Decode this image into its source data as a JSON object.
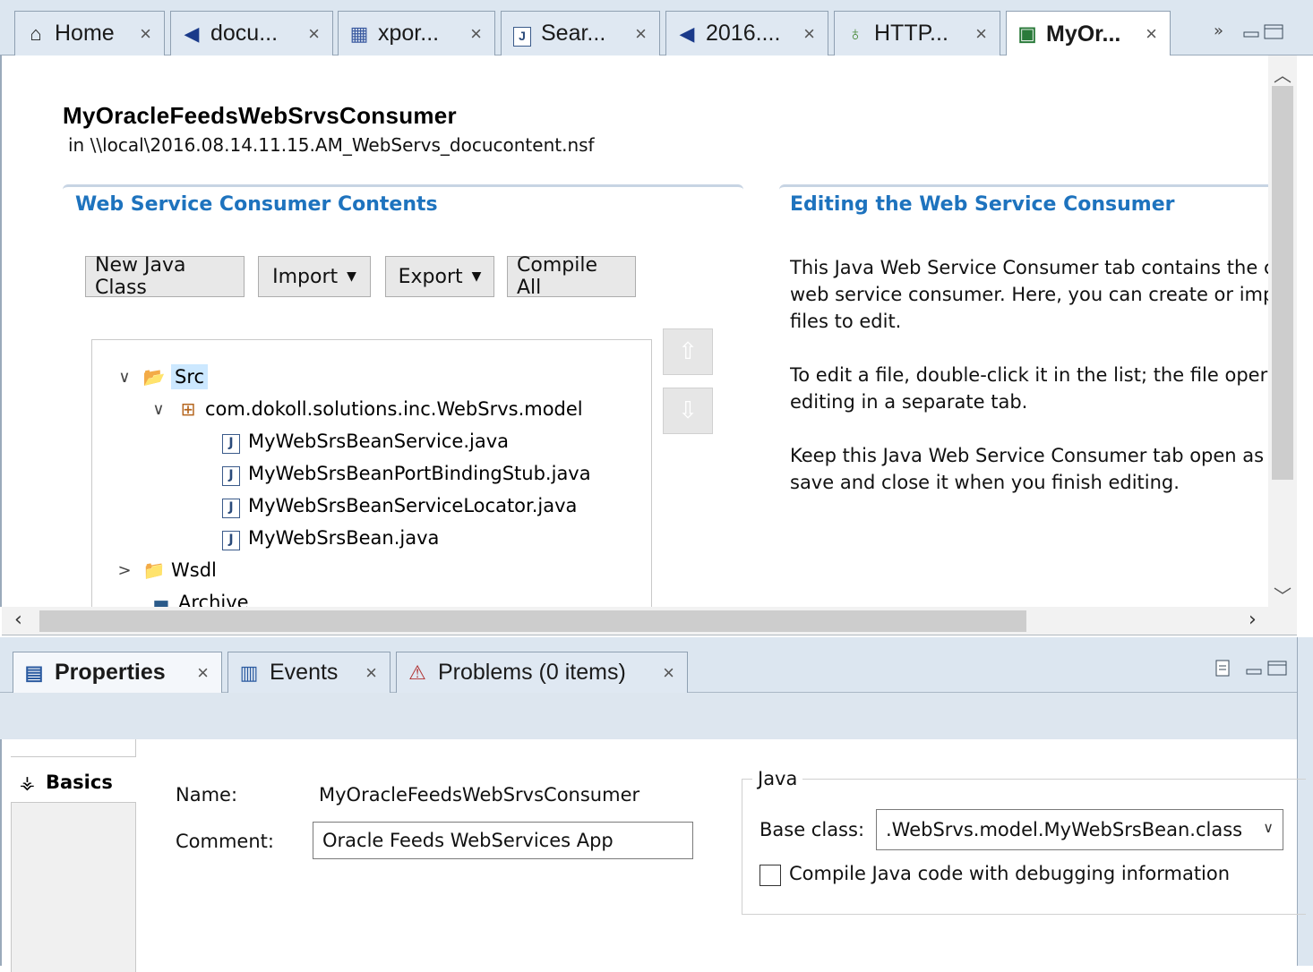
{
  "editor_tabs": [
    {
      "label": "Home",
      "icon": "home-icon",
      "glyph": "⌂"
    },
    {
      "label": "docu...",
      "icon": "flag-icon",
      "glyph": "◀"
    },
    {
      "label": "xpor...",
      "icon": "xpage-icon",
      "glyph": "▦"
    },
    {
      "label": "Sear...",
      "icon": "java-file-icon",
      "glyph": "J"
    },
    {
      "label": "2016....",
      "icon": "flag-icon",
      "glyph": "◀"
    },
    {
      "label": "HTTP...",
      "icon": "lightbulb-icon",
      "glyph": "♁"
    },
    {
      "label": "MyOr...",
      "icon": "web-service-consumer-icon",
      "glyph": "▣"
    }
  ],
  "tab_close_glyph": "×",
  "overflow_glyph": "»",
  "editor": {
    "title": "MyOracleFeedsWebSrvsConsumer",
    "path": "in \\\\local\\2016.08.14.11.15.AM_WebServs_docucontent.nsf",
    "contents_heading": "Web Service Consumer Contents",
    "editing_heading": "Editing the Web Service Consumer",
    "buttons": {
      "new_java_class": "New Java Class",
      "import": "Import",
      "export": "Export",
      "compile_all": "Compile All"
    },
    "tree": [
      {
        "label": "Src",
        "icon": "source-folder-icon",
        "glyph": "📂",
        "twisty": "∨",
        "selected": true
      },
      {
        "label": "com.dokoll.solutions.inc.WebSrvs.model",
        "icon": "package-icon",
        "glyph": "⊞",
        "twisty": "∨"
      },
      {
        "label": "MyWebSrsBeanService.java",
        "icon": "java-file-icon",
        "glyph": "J"
      },
      {
        "label": "MyWebSrsBeanPortBindingStub.java",
        "icon": "java-file-icon",
        "glyph": "J"
      },
      {
        "label": "MyWebSrsBeanServiceLocator.java",
        "icon": "java-file-icon",
        "glyph": "J"
      },
      {
        "label": "MyWebSrsBean.java",
        "icon": "java-file-icon",
        "glyph": "J"
      },
      {
        "label": "Wsdl",
        "icon": "folder-icon",
        "glyph": "📁",
        "twisty": ">"
      },
      {
        "label": "Archive",
        "icon": "archive-icon",
        "glyph": "▬"
      }
    ],
    "help_paragraphs": [
      [
        "This Java Web Service Consumer tab contains the c",
        "web service consumer. Here, you can create or imp",
        "files to edit."
      ],
      [
        "To edit a file, double-click it in the list; the file oper",
        "editing in a separate tab."
      ],
      [
        "Keep this Java Web Service Consumer tab open as y",
        "save and close it when you finish editing."
      ]
    ]
  },
  "view_tabs": [
    {
      "label": "Properties",
      "icon": "properties-icon",
      "glyph": "▤"
    },
    {
      "label": "Events",
      "icon": "events-icon",
      "glyph": "▥"
    },
    {
      "label": "Problems (0 items)",
      "icon": "problems-icon",
      "glyph": "⚠"
    }
  ],
  "properties": {
    "basics_tab": "Basics",
    "name_label": "Name:",
    "name_value": "MyOracleFeedsWebSrvsConsumer",
    "comment_label": "Comment:",
    "comment_value": "Oracle Feeds WebServices App",
    "java_group": "Java",
    "base_class_label": "Base class:",
    "base_class_value": ".WebSrvs.model.MyWebSrsBean.class",
    "debug_label": "Compile Java code with debugging information",
    "debug_checked": false
  },
  "colors": {
    "heading_blue": "#1e73be",
    "tab_strip": "#dce6f0",
    "selection": "#cce8ff"
  }
}
